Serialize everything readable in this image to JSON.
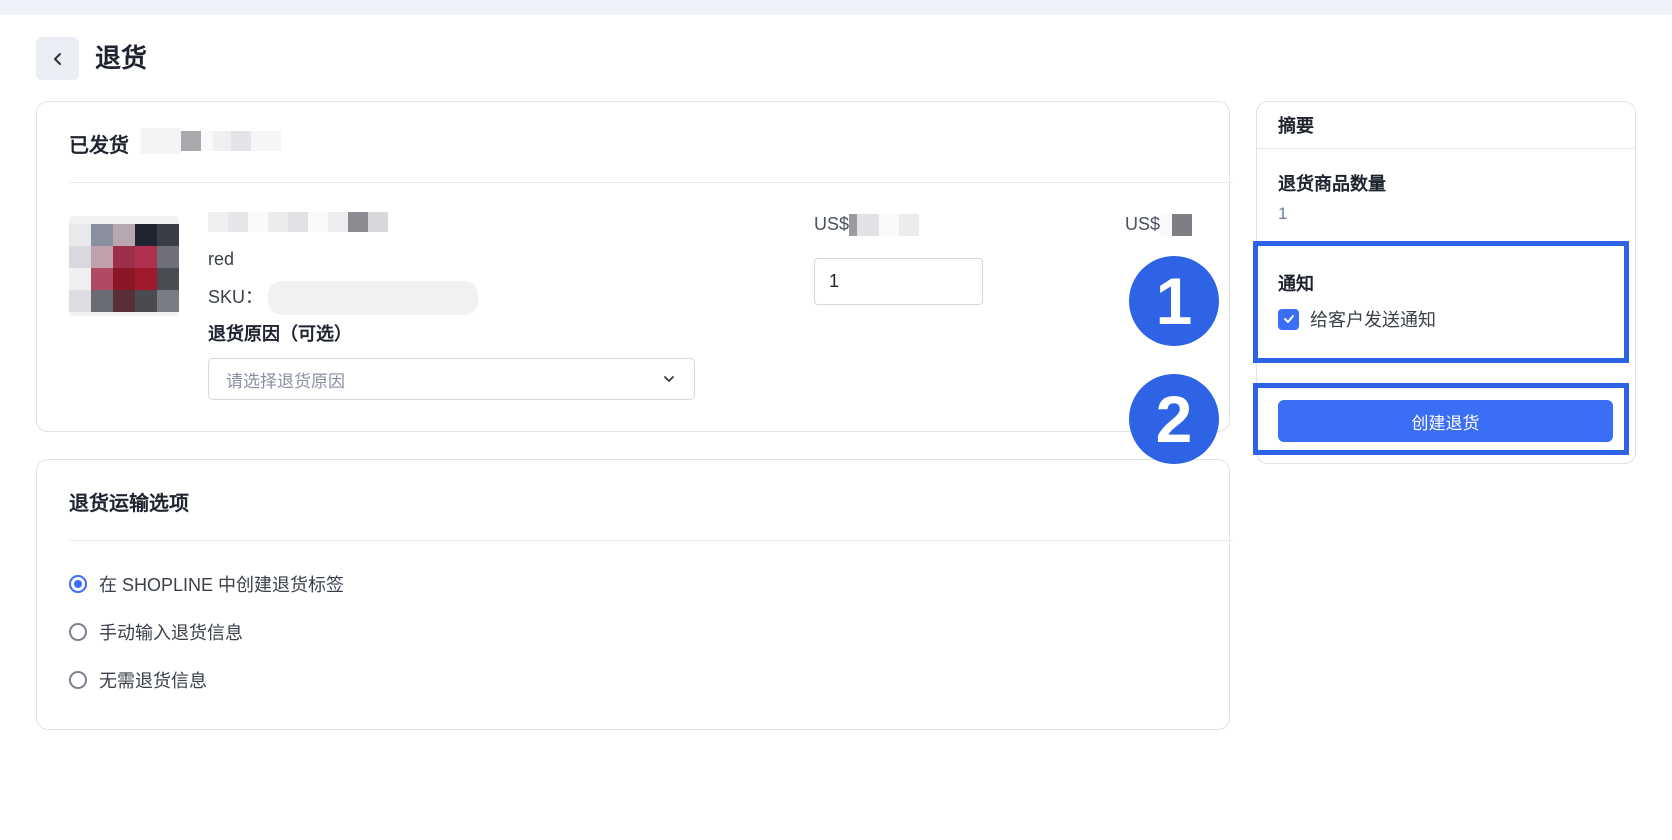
{
  "page": {
    "title": "退货"
  },
  "shipped_card": {
    "heading": "已发货",
    "item": {
      "variant": "red",
      "sku_label": "SKU：",
      "price_label": "US$",
      "total_label": "US$",
      "quantity": "1",
      "reason_label": "退货原因（可选）",
      "reason_placeholder": "请选择退货原因"
    }
  },
  "shipping_card": {
    "heading": "退货运输选项",
    "options": [
      {
        "label": "在 SHOPLINE 中创建退货标签",
        "checked": true
      },
      {
        "label": "手动输入退货信息",
        "checked": false
      },
      {
        "label": "无需退货信息",
        "checked": false
      }
    ]
  },
  "summary": {
    "title": "摘要",
    "qty_label": "退货商品数量",
    "qty_value": "1",
    "notify_title": "通知",
    "notify_checkbox_label": "给客户发送通知",
    "notify_checked": true,
    "create_button": "创建退货"
  },
  "annotations": {
    "marker_1": "1",
    "marker_2": "2",
    "highlight_color": "#2e63e6"
  },
  "colors": {
    "accent": "#3a6ef5",
    "page_strip": "#eef2fb"
  }
}
